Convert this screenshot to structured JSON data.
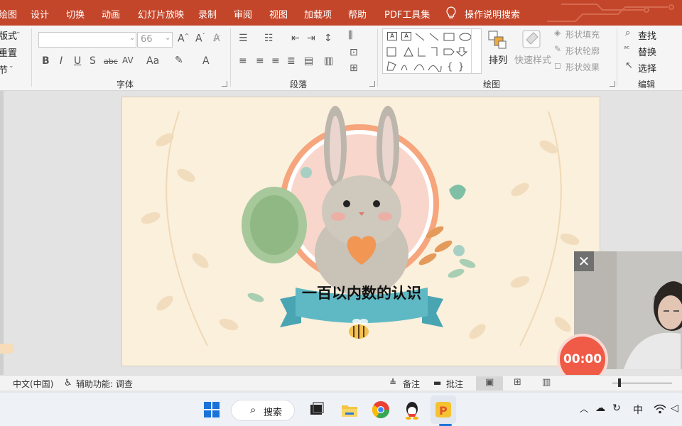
{
  "tabs": [
    {
      "label": "绘图"
    },
    {
      "label": "设计"
    },
    {
      "label": "切换"
    },
    {
      "label": "动画"
    },
    {
      "label": "幻灯片放映"
    },
    {
      "label": "录制"
    },
    {
      "label": "审阅"
    },
    {
      "label": "视图"
    },
    {
      "label": "加载项"
    },
    {
      "label": "帮助"
    },
    {
      "label": "PDF工具集"
    }
  ],
  "tell_me": "操作说明搜索",
  "ribbon": {
    "slides_group": [
      "版式",
      "重置",
      "节"
    ],
    "font_size": "66",
    "font_group_label": "字体",
    "paragraph_group_label": "段落",
    "drawing_group_label": "绘图",
    "editing_group_label": "编辑",
    "arrange_label": "排列",
    "quick_styles_label": "快速样式",
    "shape_fill": "形状填充",
    "shape_outline": "形状轮廓",
    "shape_effects": "形状效果",
    "find": "查找",
    "replace": "替换",
    "select": "选择"
  },
  "slide": {
    "title": "一百以内数的认识"
  },
  "timer": "00:00",
  "status": {
    "language": "中文(中国)",
    "accessibility": "辅助功能: 调查",
    "notes": "备注",
    "comments": "批注"
  },
  "taskbar": {
    "search": "搜索",
    "ime": "中"
  },
  "colors": {
    "tab_bar": "#c4462a",
    "ribbon_bg": "#f5f5f5",
    "slide_bg": "#fbf0dc",
    "ribbon_banner": "#5fb9c4",
    "timer_bg": "#ef5b46"
  }
}
